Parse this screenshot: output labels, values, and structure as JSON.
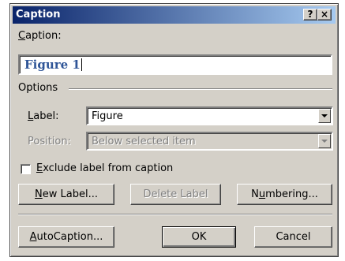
{
  "window": {
    "title": "Caption",
    "help_button": "?",
    "close_button": "×"
  },
  "caption": {
    "label": "Caption:",
    "label_accesskey": "C",
    "label_rest": "aption:",
    "value": "Figure 1"
  },
  "options": {
    "group_label": "Options",
    "label_field": {
      "accesskey": "L",
      "rest": "abel:",
      "value": "Figure"
    },
    "position_field": {
      "label": "Position:",
      "value": "Below selected item",
      "disabled": true
    },
    "exclude_checkbox": {
      "accesskey": "E",
      "rest": "xclude label from caption",
      "checked": false
    }
  },
  "buttons": {
    "new_label": {
      "accesskey": "N",
      "rest": "ew Label..."
    },
    "delete_label": "Delete Label",
    "numbering": {
      "pre": "N",
      "accesskey": "u",
      "rest": "mbering..."
    },
    "autocaption": {
      "accesskey": "A",
      "rest": "utoCaption..."
    },
    "ok": "OK",
    "cancel": "Cancel"
  }
}
